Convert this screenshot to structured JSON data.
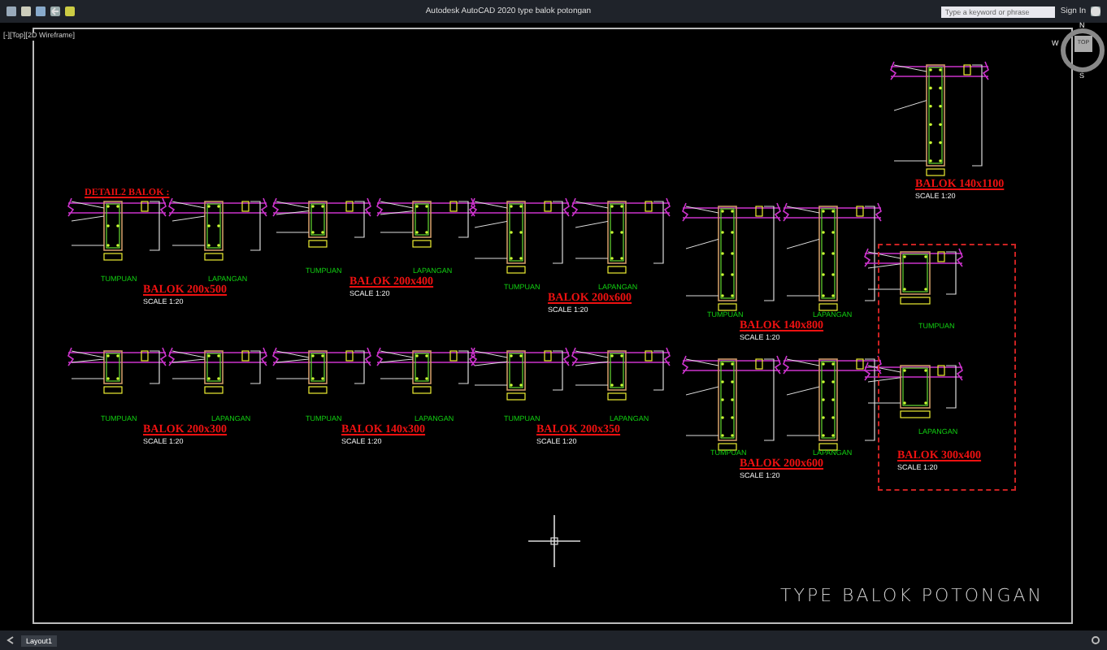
{
  "window": {
    "title": "Autodesk AutoCAD 2020  type balok potongan"
  },
  "toolbar": {
    "search": {
      "placeholder": "Type a keyword or phrase"
    },
    "sign_in": "Sign In"
  },
  "viewport": {
    "label": "[-][Top][2D Wireframe]",
    "heading": "DETAIL2 BALOK :",
    "sheet_title": "TYPE BALOK POTONGAN",
    "view_cube": {
      "north": "N",
      "south": "S",
      "west": "W",
      "face": "TOP"
    },
    "beams": [
      {
        "title": "BALOK 200x500",
        "scale": "SCALE 1:20",
        "framed": false,
        "sections": [
          {
            "label": "TUMPUAN"
          },
          {
            "label": "LAPANGAN"
          }
        ]
      },
      {
        "title": "BALOK 200x400",
        "scale": "SCALE 1:20",
        "framed": false,
        "sections": [
          {
            "label": "TUMPUAN"
          },
          {
            "label": "LAPANGAN"
          }
        ]
      },
      {
        "title": "BALOK 200x600",
        "scale": "SCALE 1:20",
        "framed": false,
        "sections": [
          {
            "label": "TUMPUAN"
          },
          {
            "label": "LAPANGAN"
          }
        ]
      },
      {
        "title": "BALOK 140x800",
        "scale": "SCALE 1:20",
        "framed": false,
        "sections": [
          {
            "label": "TUMPUAN"
          },
          {
            "label": "LAPANGAN"
          }
        ]
      },
      {
        "title": "BALOK 140x1100",
        "scale": "SCALE 1:20",
        "framed": false
      },
      {
        "title": "BALOK 200x300",
        "scale": "SCALE 1:20",
        "framed": false,
        "sections": [
          {
            "label": "TUMPUAN"
          },
          {
            "label": "LAPANGAN"
          }
        ]
      },
      {
        "title": "BALOK 140x300",
        "scale": "SCALE 1:20",
        "framed": false,
        "sections": [
          {
            "label": "TUMPUAN"
          },
          {
            "label": "LAPANGAN"
          }
        ]
      },
      {
        "title": "BALOK 200x350",
        "scale": "SCALE 1:20",
        "framed": false,
        "sections": [
          {
            "label": "TUMPUAN"
          },
          {
            "label": "LAPANGAN"
          }
        ]
      },
      {
        "title": "BALOK 200x600",
        "scale": "SCALE 1:20",
        "framed": false,
        "sections": [
          {
            "label": "TUMPUAN"
          },
          {
            "label": "LAPANGAN"
          }
        ]
      },
      {
        "title": "BALOK 300x400",
        "scale": "SCALE 1:20",
        "framed": true,
        "sections": [
          {
            "label": "TUMPUAN"
          },
          {
            "label": "LAPANGAN"
          }
        ]
      }
    ]
  },
  "layout_tabs": [
    {
      "label": "Layout1",
      "selected": true
    }
  ]
}
